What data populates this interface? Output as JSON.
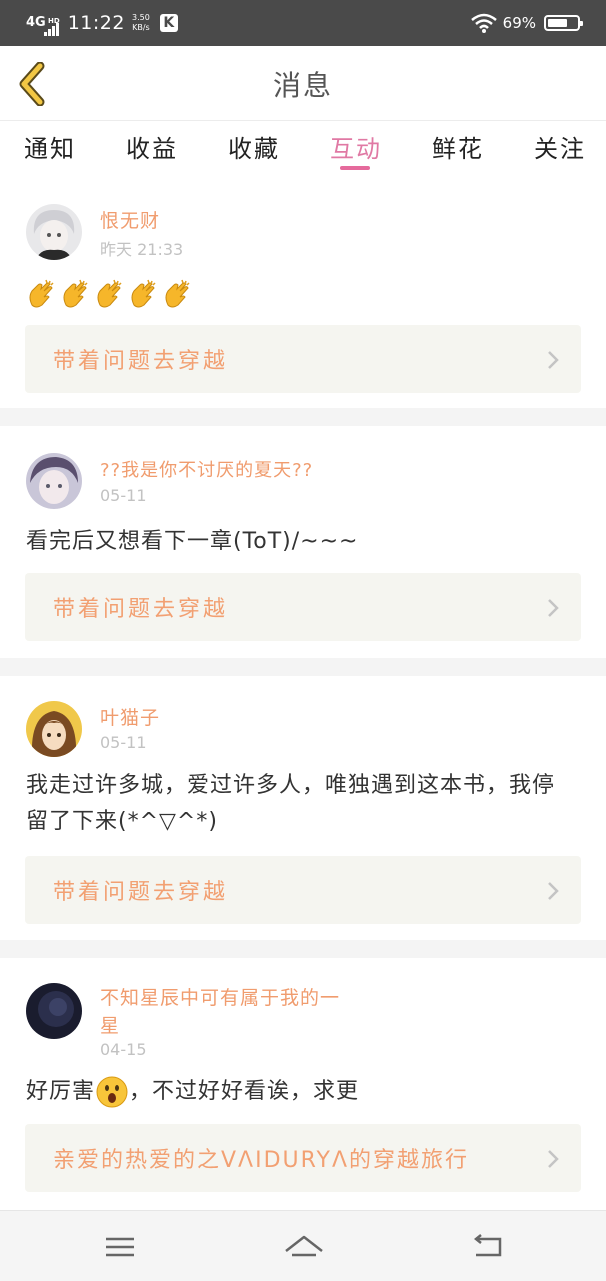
{
  "status_bar": {
    "network": "4G",
    "network_badge": "HD",
    "time": "11:22",
    "speed_value": "3.50",
    "speed_unit": "KB/s",
    "app_badge": "K",
    "battery_text": "69%",
    "battery_level": 0.69
  },
  "header": {
    "title": "消息"
  },
  "tabs": [
    {
      "label": "通知"
    },
    {
      "label": "收益"
    },
    {
      "label": "收藏"
    },
    {
      "label": "互动",
      "active": true
    },
    {
      "label": "鲜花"
    },
    {
      "label": "关注"
    }
  ],
  "messages": [
    {
      "user": "恨无财",
      "date": "昨天 21:33",
      "content": "",
      "emoji": "clapping-hands-x5",
      "link": "带着问题去穿越"
    },
    {
      "user": "??我是你不讨厌的夏天??",
      "date": "05-11",
      "content": "看完后又想看下一章(ToT)/~~~",
      "link": "带着问题去穿越"
    },
    {
      "user": "叶猫子",
      "date": "05-11",
      "content": "我走过许多城，爱过许多人，唯独遇到这本书，我停留了下来(*^▽^*)",
      "link": "带着问题去穿越"
    },
    {
      "user_line1": "不知星辰中可有属于我的一",
      "user_line2": "星",
      "date": "04-15",
      "content_before": "好厉害",
      "content_after": "，不过好好看诶，求更",
      "emoji": "astonished-face",
      "link": "亲爱的热爱的之VΛIDURYΛ的穿越旅行"
    }
  ],
  "colors": {
    "accent_pink": "#e56a9c",
    "username_orange": "#f09c6e",
    "link_orange": "#f2a072",
    "link_bg": "#f5f5f0",
    "back_chevron": "#f2c744"
  },
  "icons": {
    "back": "back-chevron-icon",
    "link_arrow": "chevron-right-icon",
    "nav_menu": "menu-icon",
    "nav_home": "home-icon",
    "nav_back": "back-arrow-icon"
  }
}
